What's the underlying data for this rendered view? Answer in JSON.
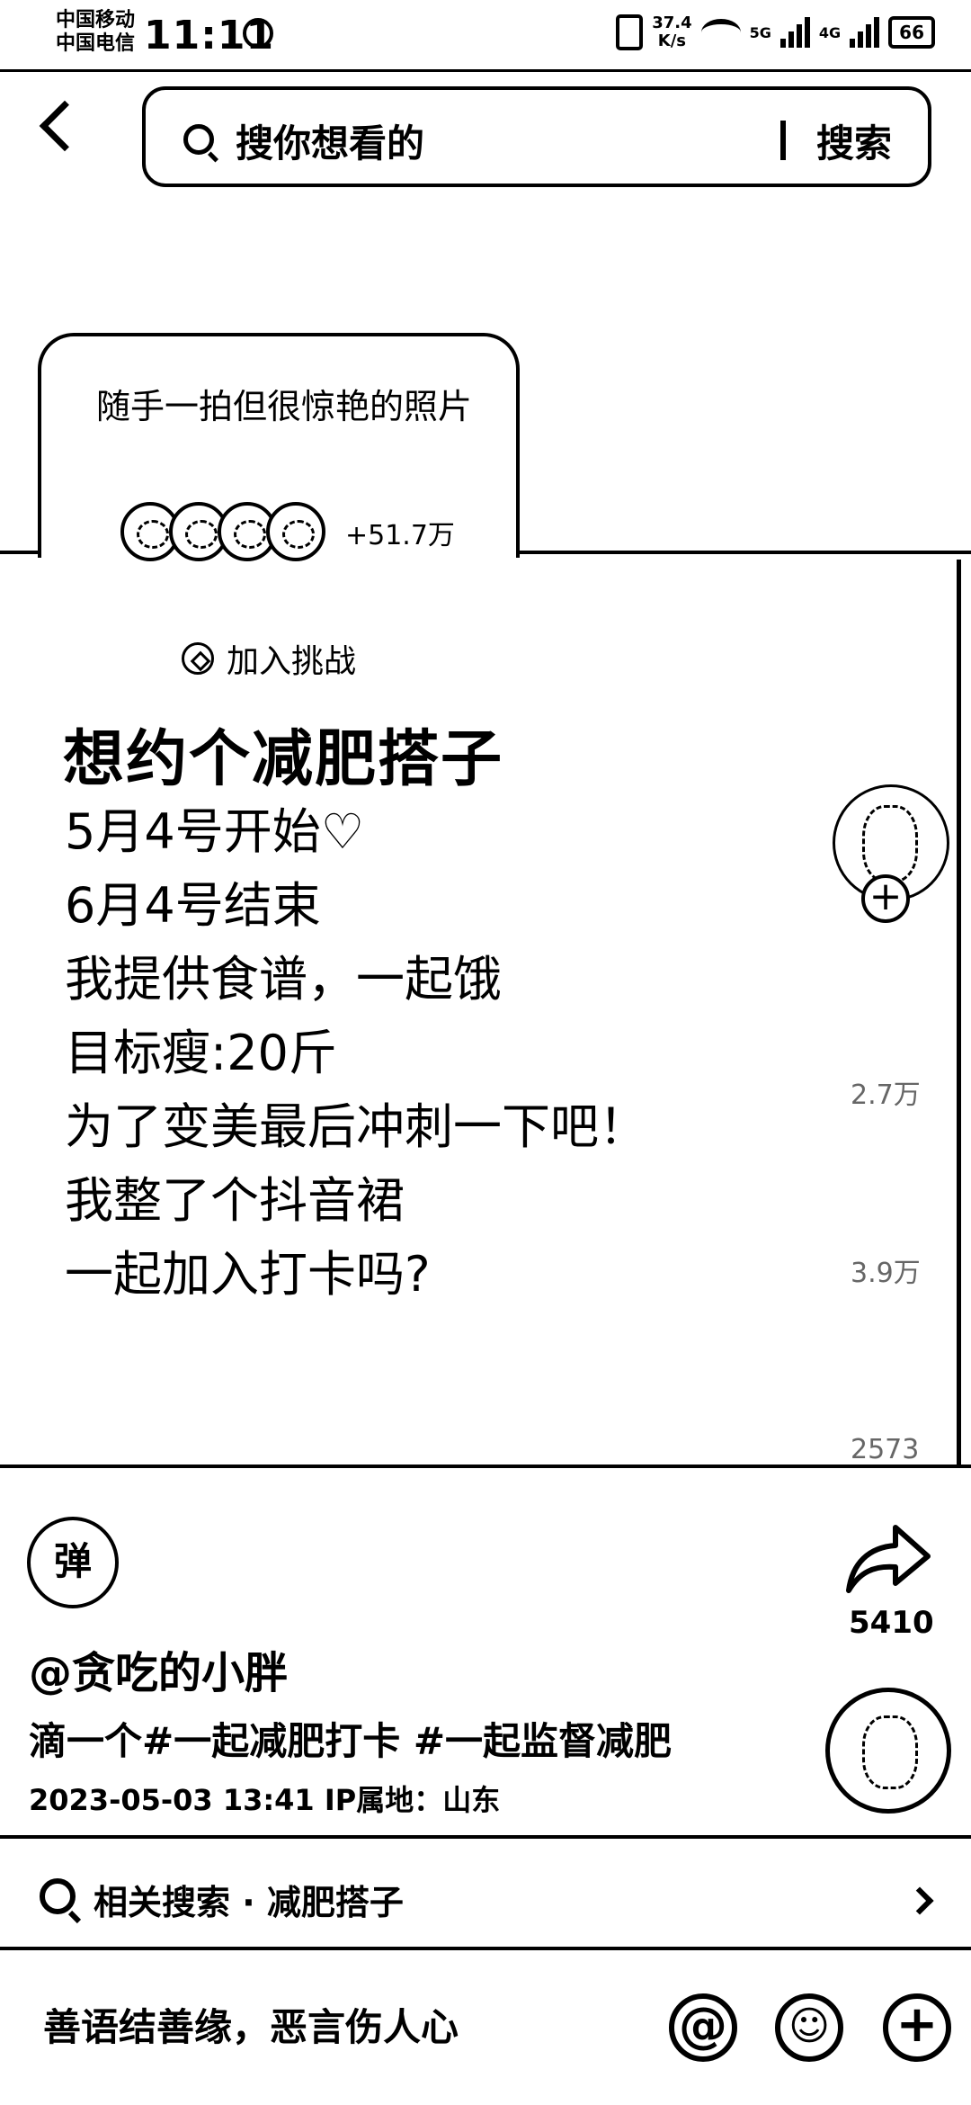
{
  "status_bar": {
    "carrier_1": "中国移动",
    "carrier_2": "中国电信",
    "time": "11:11",
    "net_speed_value": "37.4",
    "net_speed_unit": "K/s",
    "network_1": "5G",
    "network_2": "4G",
    "battery": "66"
  },
  "search": {
    "placeholder": "搜你想看的",
    "button": "搜索"
  },
  "challenge": {
    "title": "随手一拍但很惊艳的照片",
    "participants": "+51.7万"
  },
  "post": {
    "join_label": "加入挑战",
    "title": "想约个减肥搭子",
    "lines": [
      "5月4号开始♡",
      "6月4号结束",
      "我提供食谱，一起饿",
      "目标瘦:20斤",
      "为了变美最后冲刺一下吧！",
      "我整了个抖音裙",
      "一起加入打卡吗?"
    ]
  },
  "side_stats": {
    "likes": "2.7万",
    "comments": "3.9万",
    "favorites": "2573",
    "shares": "5410"
  },
  "video_info": {
    "danmu": "弹",
    "username": "@贪吃的小胖",
    "description": "滴一个#一起减肥打卡 #一起监督减肥",
    "meta": "2023-05-03 13:41  IP属地：山东"
  },
  "related_search": {
    "text": "相关搜索 · 减肥搭子"
  },
  "comment_bar": {
    "placeholder": "善语结善缘，恶言伤人心",
    "at_symbol": "@",
    "plus_symbol": "+"
  }
}
